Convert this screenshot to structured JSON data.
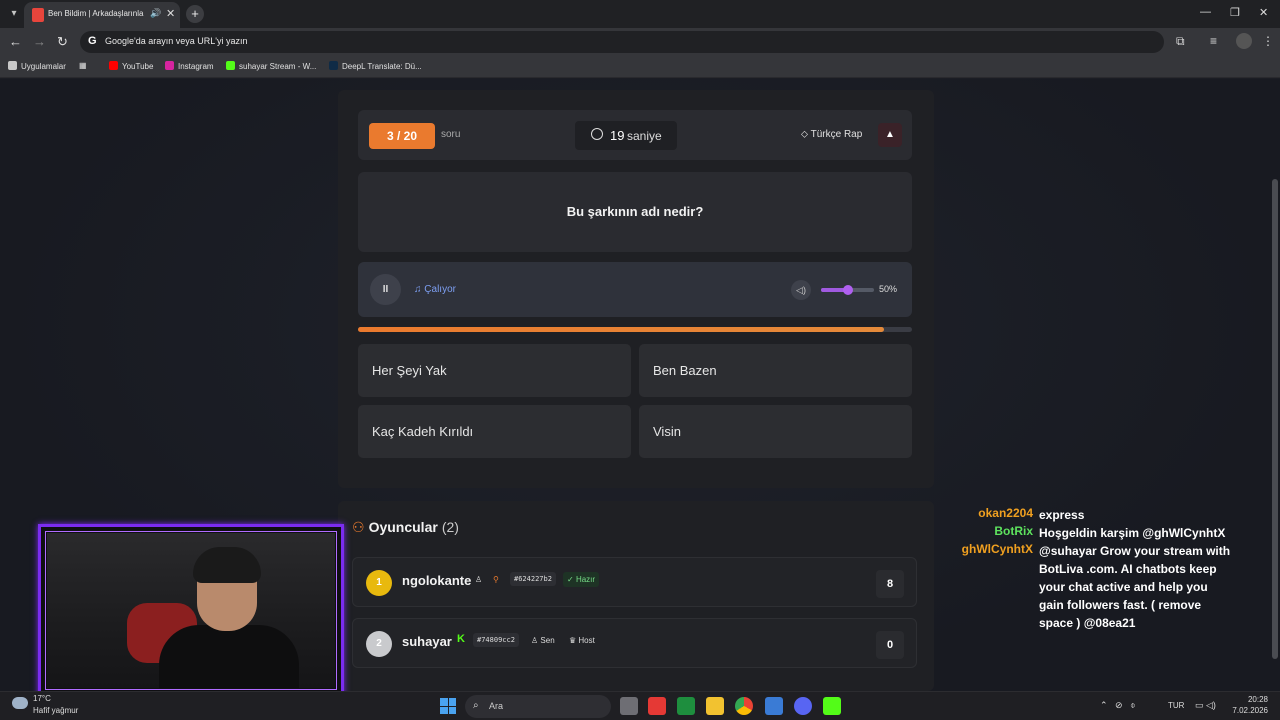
{
  "browser": {
    "tab_title": "Ben Bildim | Arkadaşlarınla",
    "omnibox_text": "Google'da arayın veya URL'yi yazın",
    "bookmarks": [
      "Uygulamalar",
      "YouTube",
      "Instagram",
      "suhayar Stream - W...",
      "DeepL Translate: Dü..."
    ]
  },
  "quiz": {
    "counter": "3 / 20",
    "counter_suffix": "soru",
    "timer_value": "19",
    "timer_label": "saniye",
    "category": "Türkçe Rap",
    "question": "Bu şarkının adı nedir?",
    "player_status": "Çalıyor",
    "volume_label": "50%",
    "volume_fraction": 0.5,
    "progress_fraction": 0.95,
    "answers": [
      "Her Şeyi Yak",
      "Ben Bazen",
      "Kaç Kadeh Kırıldı",
      "Visin"
    ]
  },
  "players": {
    "title": "Oyuncular",
    "count": "(2)",
    "list": [
      {
        "rank": "1",
        "name": "ngolokante",
        "hash": "#624227b2",
        "status": "Hazır",
        "score": "8"
      },
      {
        "rank": "2",
        "name": "suhayar",
        "hash": "#74809cc2",
        "you_label": "Sen",
        "host_label": "Host",
        "score": "0"
      }
    ]
  },
  "chat": [
    {
      "user": "okan2204",
      "color": "#f0a020",
      "message": "express"
    },
    {
      "user": "BotRix",
      "color": "#5ee35e",
      "message": "Hoşgeldin karşim @ghWlCynhtX"
    },
    {
      "user": "ghWlCynhtX",
      "color": "#f0a020",
      "message": "@suhayar Grow your stream with BotLiva .com. AI chatbots keep your chat active and help you gain followers fast. ( remove space ) @08ea21"
    }
  ],
  "taskbar": {
    "weather_temp": "17°C",
    "weather_desc": "Hafif yağmur",
    "search_label": "Ara",
    "language": "TUR",
    "time": "20:28",
    "date": "7.02.2026"
  },
  "colors": {
    "accent": "#ea7a2e",
    "volume": "#a05ae0",
    "webcam_frame": "#7b2cf0"
  }
}
